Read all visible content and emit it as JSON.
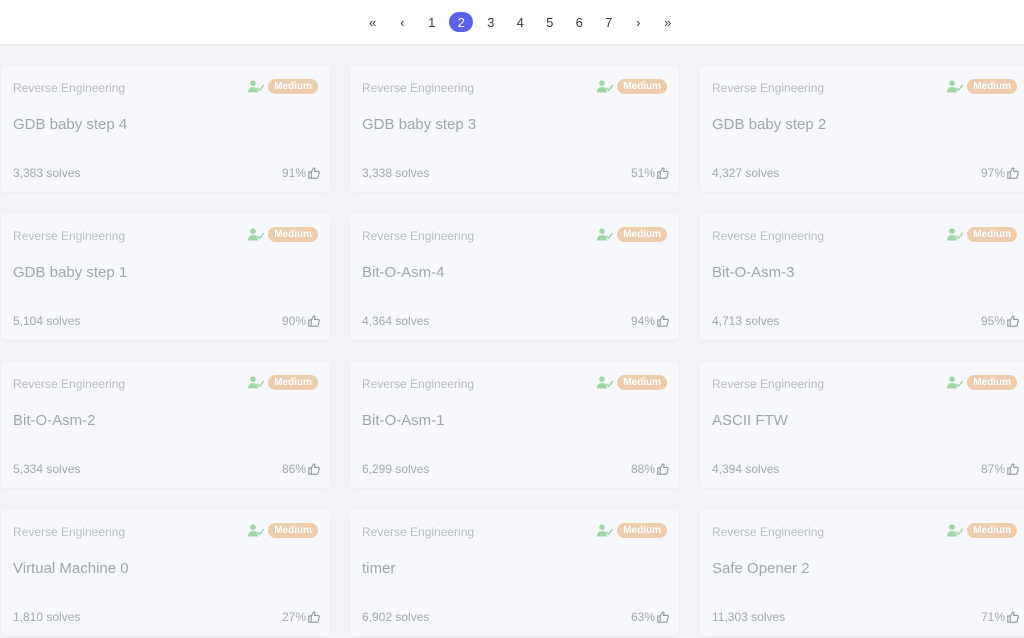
{
  "pagination": {
    "first": "«",
    "prev": "‹",
    "pages": [
      "1",
      "2",
      "3",
      "4",
      "5",
      "6",
      "7"
    ],
    "current": "2",
    "next": "›",
    "last": "»"
  },
  "colors": {
    "accent": "#5a62e8",
    "difficulty_badge": "#eecdaf",
    "solved_user_icon": "#9fd6a8"
  },
  "card_icons": {
    "solver": "user-check-icon",
    "rating": "thumbs-up-icon"
  },
  "challenges": [
    {
      "category": "Reverse Engineering",
      "difficulty": "Medium",
      "title": "GDB baby step 4",
      "solves": "3,383 solves",
      "rating": "91%"
    },
    {
      "category": "Reverse Engineering",
      "difficulty": "Medium",
      "title": "GDB baby step 3",
      "solves": "3,338 solves",
      "rating": "51%"
    },
    {
      "category": "Reverse Engineering",
      "difficulty": "Medium",
      "title": "GDB baby step 2",
      "solves": "4,327 solves",
      "rating": "97%"
    },
    {
      "category": "Reverse Engineering",
      "difficulty": "Medium",
      "title": "GDB baby step 1",
      "solves": "5,104 solves",
      "rating": "90%"
    },
    {
      "category": "Reverse Engineering",
      "difficulty": "Medium",
      "title": "Bit-O-Asm-4",
      "solves": "4,364 solves",
      "rating": "94%"
    },
    {
      "category": "Reverse Engineering",
      "difficulty": "Medium",
      "title": "Bit-O-Asm-3",
      "solves": "4,713 solves",
      "rating": "95%"
    },
    {
      "category": "Reverse Engineering",
      "difficulty": "Medium",
      "title": "Bit-O-Asm-2",
      "solves": "5,334 solves",
      "rating": "86%"
    },
    {
      "category": "Reverse Engineering",
      "difficulty": "Medium",
      "title": "Bit-O-Asm-1",
      "solves": "6,299 solves",
      "rating": "88%"
    },
    {
      "category": "Reverse Engineering",
      "difficulty": "Medium",
      "title": "ASCII FTW",
      "solves": "4,394 solves",
      "rating": "87%"
    },
    {
      "category": "Reverse Engineering",
      "difficulty": "Medium",
      "title": "Virtual Machine 0",
      "solves": "1,810 solves",
      "rating": "27%"
    },
    {
      "category": "Reverse Engineering",
      "difficulty": "Medium",
      "title": "timer",
      "solves": "6,902 solves",
      "rating": "63%"
    },
    {
      "category": "Reverse Engineering",
      "difficulty": "Medium",
      "title": "Safe Opener 2",
      "solves": "11,303 solves",
      "rating": "71%"
    }
  ]
}
